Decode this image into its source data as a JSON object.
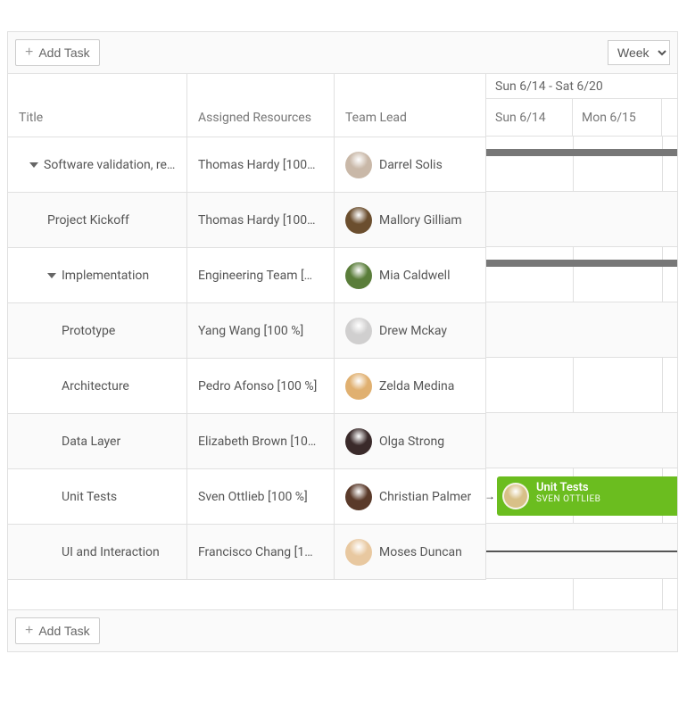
{
  "toolbar": {
    "add_label": "Add Task",
    "view_value": "Week"
  },
  "columns": {
    "title": "Title",
    "resources": "Assigned Resources",
    "lead": "Team Lead"
  },
  "timeline": {
    "range_label": "Sun 6/14 - Sat 6/20",
    "days": {
      "sun": "Sun 6/14",
      "mon": "Mon 6/15"
    }
  },
  "rows": [
    {
      "title": "Software validation, res…",
      "resources": "Thomas Hardy [100…",
      "lead": "Darrel Solis",
      "avatar_color": "#c9b8a8",
      "indent": 1,
      "toggle": true
    },
    {
      "title": "Project Kickoff",
      "resources": "Thomas Hardy [100…",
      "lead": "Mallory Gilliam",
      "avatar_color": "#6b4e2e",
      "indent": 2,
      "toggle": false
    },
    {
      "title": "Implementation",
      "resources": "Engineering Team [​…",
      "lead": "Mia Caldwell",
      "avatar_color": "#5a7d3a",
      "indent": 2,
      "toggle": true
    },
    {
      "title": "Prototype",
      "resources": "Yang Wang [100 %]",
      "lead": "Drew Mckay",
      "avatar_color": "#d0cfcf",
      "indent": 3,
      "toggle": false
    },
    {
      "title": "Architecture",
      "resources": "Pedro Afonso [100 %]",
      "lead": "Zelda Medina",
      "avatar_color": "#e0b070",
      "indent": 3,
      "toggle": false
    },
    {
      "title": "Data Layer",
      "resources": "Elizabeth Brown [10…",
      "lead": "Olga Strong",
      "avatar_color": "#3a2a2a",
      "indent": 3,
      "toggle": false
    },
    {
      "title": "Unit Tests",
      "resources": "Sven Ottlieb [100 %]",
      "lead": "Christian Palmer",
      "avatar_color": "#5a3a2a",
      "indent": 3,
      "toggle": false
    },
    {
      "title": "UI and Interaction",
      "resources": "Francisco Chang [1…",
      "lead": "Moses Duncan",
      "avatar_color": "#e8c8a0",
      "indent": 3,
      "toggle": false
    }
  ],
  "task_bar": {
    "title": "Unit Tests",
    "subtitle": "SVEN OTTLIEB",
    "avatar_color": "#d8c088"
  }
}
